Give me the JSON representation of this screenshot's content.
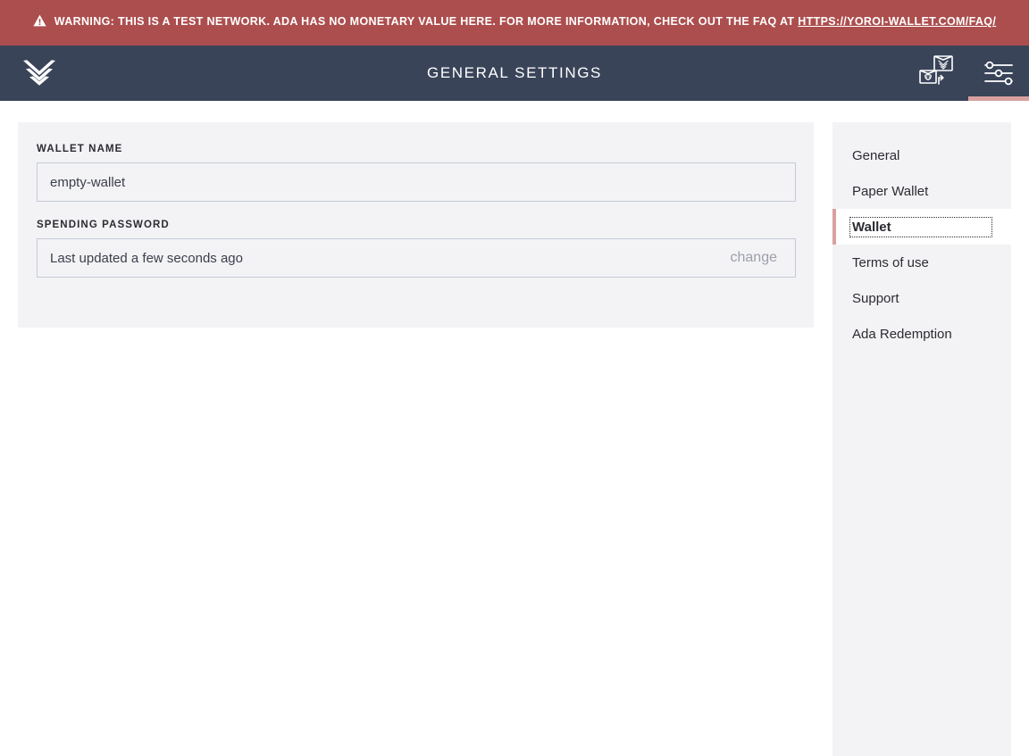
{
  "banner": {
    "icon": "warning-triangle-icon",
    "text": "WARNING: THIS IS A TEST NETWORK. ADA HAS NO MONETARY VALUE HERE. FOR MORE INFORMATION, CHECK OUT THE FAQ AT ",
    "link_text": "HTTPS://YOROI-WALLET.COM/FAQ/",
    "background_color": "#ad4e4e"
  },
  "topbar": {
    "logo_icon": "yoroi-chevron-logo-icon",
    "title": "GENERAL SETTINGS",
    "background_color": "#394459",
    "actions": [
      {
        "name": "wallet-switch-icon",
        "label": "Switch wallet",
        "active": false
      },
      {
        "name": "settings-sliders-icon",
        "label": "Settings",
        "active": true
      }
    ],
    "active_indicator_color": "#d9a0a0"
  },
  "main": {
    "wallet_name": {
      "label": "WALLET NAME",
      "value": "empty-wallet",
      "placeholder": "Wallet name"
    },
    "spending_password": {
      "label": "SPENDING PASSWORD",
      "value": "Last updated a few seconds ago",
      "action_label": "change"
    }
  },
  "sidebar": {
    "items": [
      {
        "label": "General",
        "active": false
      },
      {
        "label": "Paper Wallet",
        "active": false
      },
      {
        "label": "Wallet",
        "active": true
      },
      {
        "label": "Terms of use",
        "active": false
      },
      {
        "label": "Support",
        "active": false
      },
      {
        "label": "Ada Redemption",
        "active": false
      }
    ],
    "active_bar_color": "#d9a0a0",
    "background_color": "#f3f3f5"
  }
}
